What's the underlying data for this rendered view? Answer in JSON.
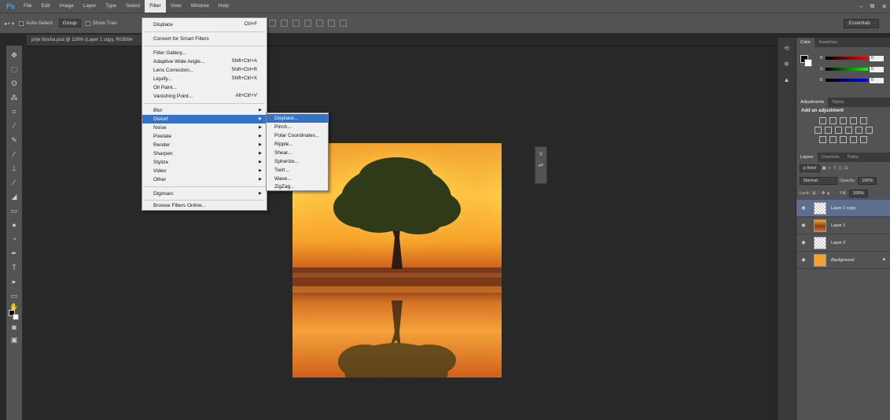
{
  "app": {
    "logo": "Ps",
    "menus": [
      "File",
      "Edit",
      "Image",
      "Layer",
      "Type",
      "Select",
      "Filter",
      "View",
      "Window",
      "Help"
    ],
    "active_menu": "Filter",
    "window_controls": [
      "–",
      "⧉",
      "✕"
    ]
  },
  "options_bar": {
    "move_tool_icon": "▸+ ▾",
    "auto_select_label": "Auto-Select:",
    "auto_select_value": "Group",
    "show_transform_label": "Show Tran",
    "workspace": "Essentials"
  },
  "document": {
    "tab_title": "prije finisha.psd @ 100% (Layer 1 copy, RGB/8#"
  },
  "filter_menu": {
    "last_filter": {
      "label": "Displace",
      "shortcut": "Ctrl+F"
    },
    "convert_smart": "Convert for Smart Filters",
    "items_group1": [
      {
        "label": "Filter Gallery...",
        "shortcut": ""
      },
      {
        "label": "Adaptive Wide Angle...",
        "shortcut": "Shift+Ctrl+A"
      },
      {
        "label": "Lens Correction...",
        "shortcut": "Shift+Ctrl+R"
      },
      {
        "label": "Liquify...",
        "shortcut": "Shift+Ctrl+X"
      },
      {
        "label": "Oil Paint...",
        "shortcut": ""
      },
      {
        "label": "Vanishing Point...",
        "shortcut": "Alt+Ctrl+V"
      }
    ],
    "items_group2": [
      "Blur",
      "Distort",
      "Noise",
      "Pixelate",
      "Render",
      "Sharpen",
      "Stylize",
      "Video",
      "Other"
    ],
    "highlighted": "Distort",
    "digimarc": "Digimarc",
    "browse_online": "Browse Filters Online..."
  },
  "distort_submenu": {
    "items": [
      "Displace...",
      "Pinch...",
      "Polar Coordinates...",
      "Ripple...",
      "Shear...",
      "Spherize...",
      "Twirl...",
      "Wave...",
      "ZigZag..."
    ],
    "highlighted": "Displace..."
  },
  "right_panel": {
    "color_tabs": [
      "Color",
      "Swatches"
    ],
    "color_channels": [
      {
        "label": "R",
        "value": "0"
      },
      {
        "label": "G",
        "value": "0"
      },
      {
        "label": "B",
        "value": "0"
      }
    ],
    "adjustment_tabs": [
      "Adjustments",
      "Styles"
    ],
    "add_adjustment": "Add an adjustment",
    "layer_tabs": [
      "Layers",
      "Channels",
      "Paths"
    ],
    "kind_filter": "ρ Kind",
    "blend_mode": "Normal",
    "opacity_label": "Opacity:",
    "opacity_value": "100%",
    "lock_label": "Lock:",
    "fill_label": "Fill:",
    "fill_value": "100%",
    "layers": [
      {
        "name": "Layer 1 copy",
        "thumb": "checker",
        "selected": true
      },
      {
        "name": "Layer 1",
        "thumb": "sunset",
        "selected": false
      },
      {
        "name": "Layer 2",
        "thumb": "checker",
        "selected": false
      },
      {
        "name": "Background",
        "thumb": "bg",
        "selected": false
      }
    ]
  },
  "colors": {
    "menu_bg": "#535353",
    "highlight": "#3373c6",
    "workspace_bg": "#282828"
  }
}
